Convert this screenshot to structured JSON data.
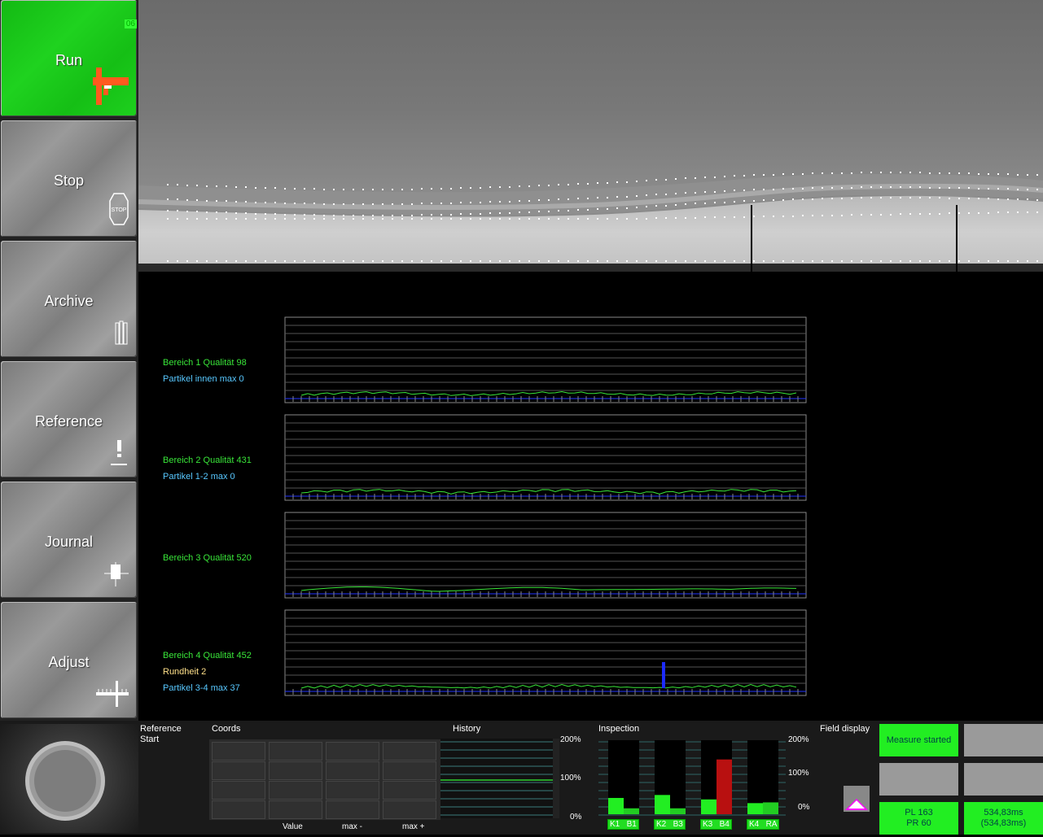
{
  "version_badge": "06",
  "sidebar": {
    "buttons": [
      {
        "label": "Run",
        "icon": "caliper-icon",
        "active": true
      },
      {
        "label": "Stop",
        "icon": "stop-sign-icon"
      },
      {
        "label": "Archive",
        "icon": "archive-icon"
      },
      {
        "label": "Reference",
        "icon": "exclamation-icon"
      },
      {
        "label": "Journal",
        "icon": "journal-icon"
      },
      {
        "label": "Adjust",
        "icon": "ruler-icon"
      }
    ]
  },
  "stop_icon_text": "STOP",
  "charts": [
    {
      "labels": [
        {
          "text": "Bereich 1 Qualität 98",
          "color": "green"
        },
        {
          "text": "Partikel innen max 0",
          "color": "cyan"
        }
      ]
    },
    {
      "labels": [
        {
          "text": "Bereich 2 Qualität 431",
          "color": "green"
        },
        {
          "text": "Partikel 1-2 max 0",
          "color": "cyan"
        }
      ]
    },
    {
      "labels": [
        {
          "text": "Bereich 3 Qualität 520",
          "color": "green"
        }
      ]
    },
    {
      "labels": [
        {
          "text": "Bereich 4 Qualität 452",
          "color": "green"
        },
        {
          "text": "Rundheit 2",
          "color": "yellow"
        },
        {
          "text": "Partikel 3-4 max 37",
          "color": "cyan"
        }
      ]
    }
  ],
  "bottom": {
    "reference_line1": "Reference",
    "reference_line2": "Start",
    "coords_title": "Coords",
    "coords_cols": [
      "Value",
      "max -",
      "max +"
    ],
    "history_title": "History",
    "history_scale": [
      "200%",
      "100%",
      "0%"
    ],
    "inspection_title": "Inspection",
    "inspection_scale": [
      "200%",
      "100%",
      "0%"
    ],
    "inspection_bars": [
      {
        "labels": [
          "K1",
          "B1"
        ],
        "k_level": 0.22,
        "b_level": 0.08,
        "b_red": false
      },
      {
        "labels": [
          "K2",
          "B3"
        ],
        "k_level": 0.26,
        "b_level": 0.08,
        "b_red": false
      },
      {
        "labels": [
          "K3",
          "B4"
        ],
        "k_level": 0.2,
        "b_level": 0.74,
        "b_red": true
      },
      {
        "labels": [
          "K4",
          "RA"
        ],
        "k_level": 0.15,
        "b_level": 0.16,
        "b_red": false
      }
    ],
    "field_display_title": "Field display",
    "status": {
      "measure": "Measure started",
      "pl": "PL 163",
      "pr": "PR 60",
      "time1": "534,83ms",
      "time2": "(534,83ms)"
    }
  }
}
